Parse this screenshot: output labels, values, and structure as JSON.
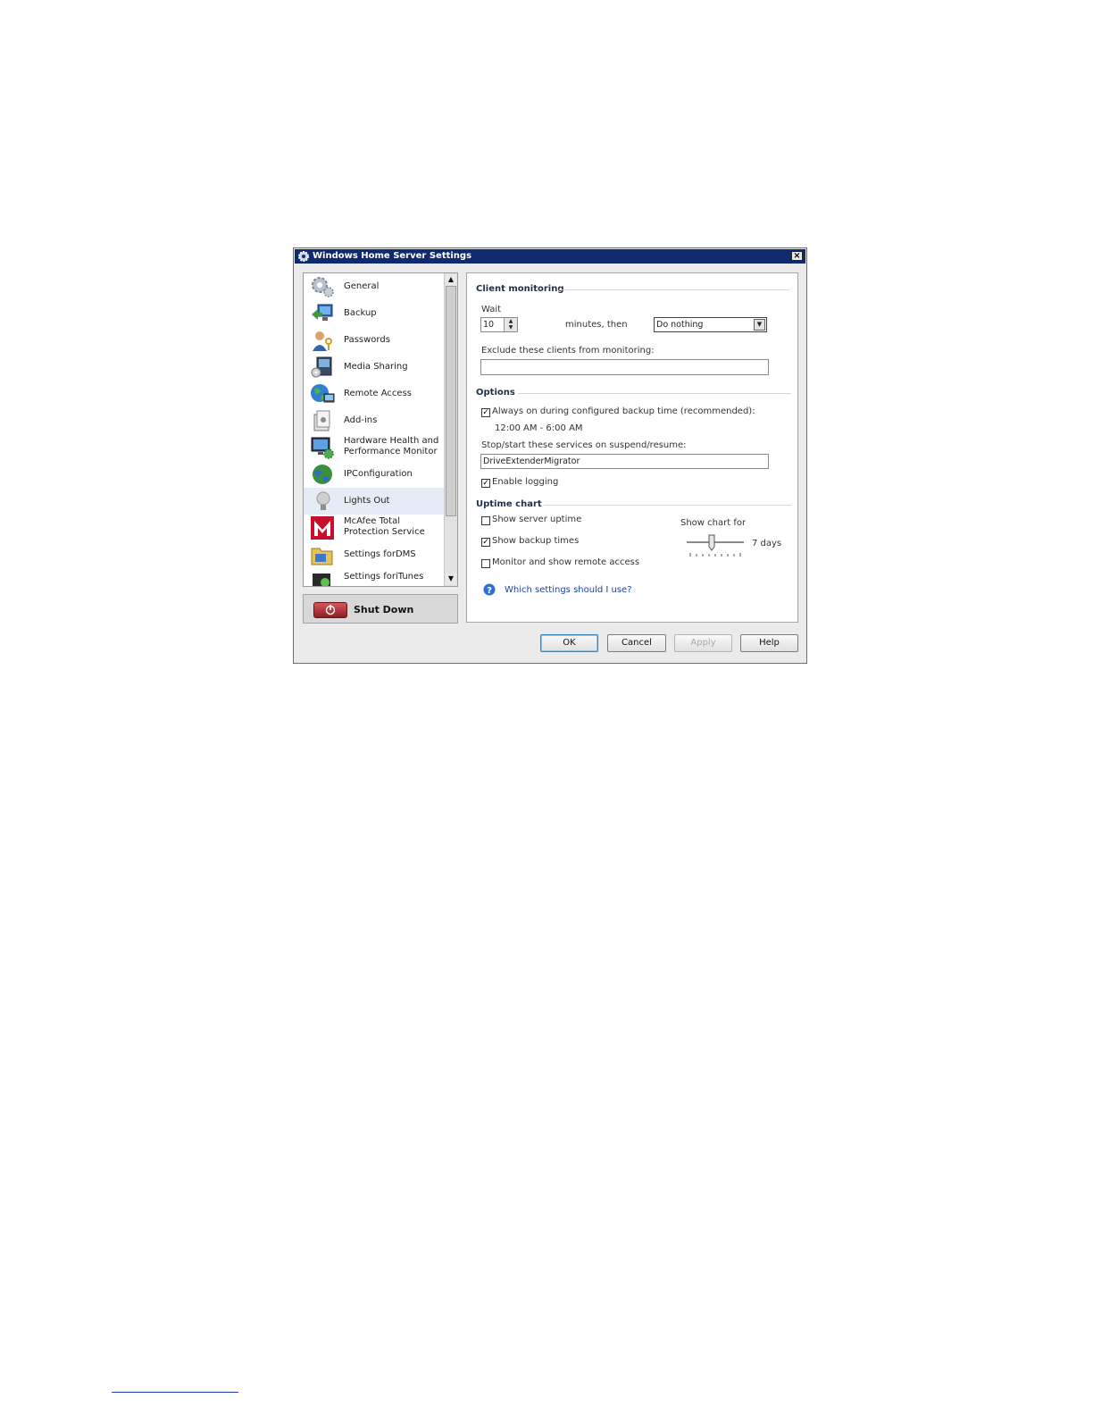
{
  "window": {
    "title": "Windows Home Server Settings",
    "close_label": "×"
  },
  "nav": {
    "items": [
      {
        "label": "General"
      },
      {
        "label": "Backup"
      },
      {
        "label": "Passwords"
      },
      {
        "label": "Media Sharing"
      },
      {
        "label": "Remote Access"
      },
      {
        "label": "Add-ins"
      },
      {
        "label": "Hardware Health and Performance Monitor"
      },
      {
        "label": "IPConfiguration"
      },
      {
        "label": "Lights Out"
      },
      {
        "label": "McAfee Total Protection Service"
      },
      {
        "label": "Settings forDMS"
      },
      {
        "label": "Settings foriTunes"
      }
    ],
    "selected": "Lights Out",
    "scroll_up": "▲",
    "scroll_down": "▼"
  },
  "shutdown": {
    "label": "Shut Down"
  },
  "client_monitoring": {
    "heading": "Client monitoring",
    "wait_label": "Wait",
    "wait_value": "10",
    "minutes_label": "minutes, then",
    "action_value": "Do nothing",
    "exclude_label": "Exclude these clients from monitoring:",
    "exclude_value": ""
  },
  "options": {
    "heading": "Options",
    "always_on_label": "Always on during configured backup time (recommended):",
    "always_on_checked": true,
    "backup_time": "12:00 AM - 6:00 AM",
    "services_label": "Stop/start these services on suspend/resume:",
    "services_value": "DriveExtenderMigrator",
    "logging_label": "Enable logging",
    "logging_checked": true
  },
  "uptime": {
    "heading": "Uptime chart",
    "show_uptime_label": "Show server uptime",
    "show_uptime_checked": false,
    "show_backup_label": "Show backup times",
    "show_backup_checked": true,
    "monitor_remote_label": "Monitor and show remote access",
    "monitor_remote_checked": false,
    "show_chart_for_label": "Show chart for",
    "chart_days": "7 days",
    "slider_fraction": 0.5
  },
  "help_link": {
    "label": "Which settings should I use?",
    "icon": "question-icon"
  },
  "buttons": {
    "ok": "OK",
    "cancel": "Cancel",
    "apply": "Apply",
    "help": "Help"
  },
  "colors": {
    "titlebar": "#0f2a6e",
    "link": "#1f3fa0",
    "shutdown_red": "#b8333a"
  }
}
